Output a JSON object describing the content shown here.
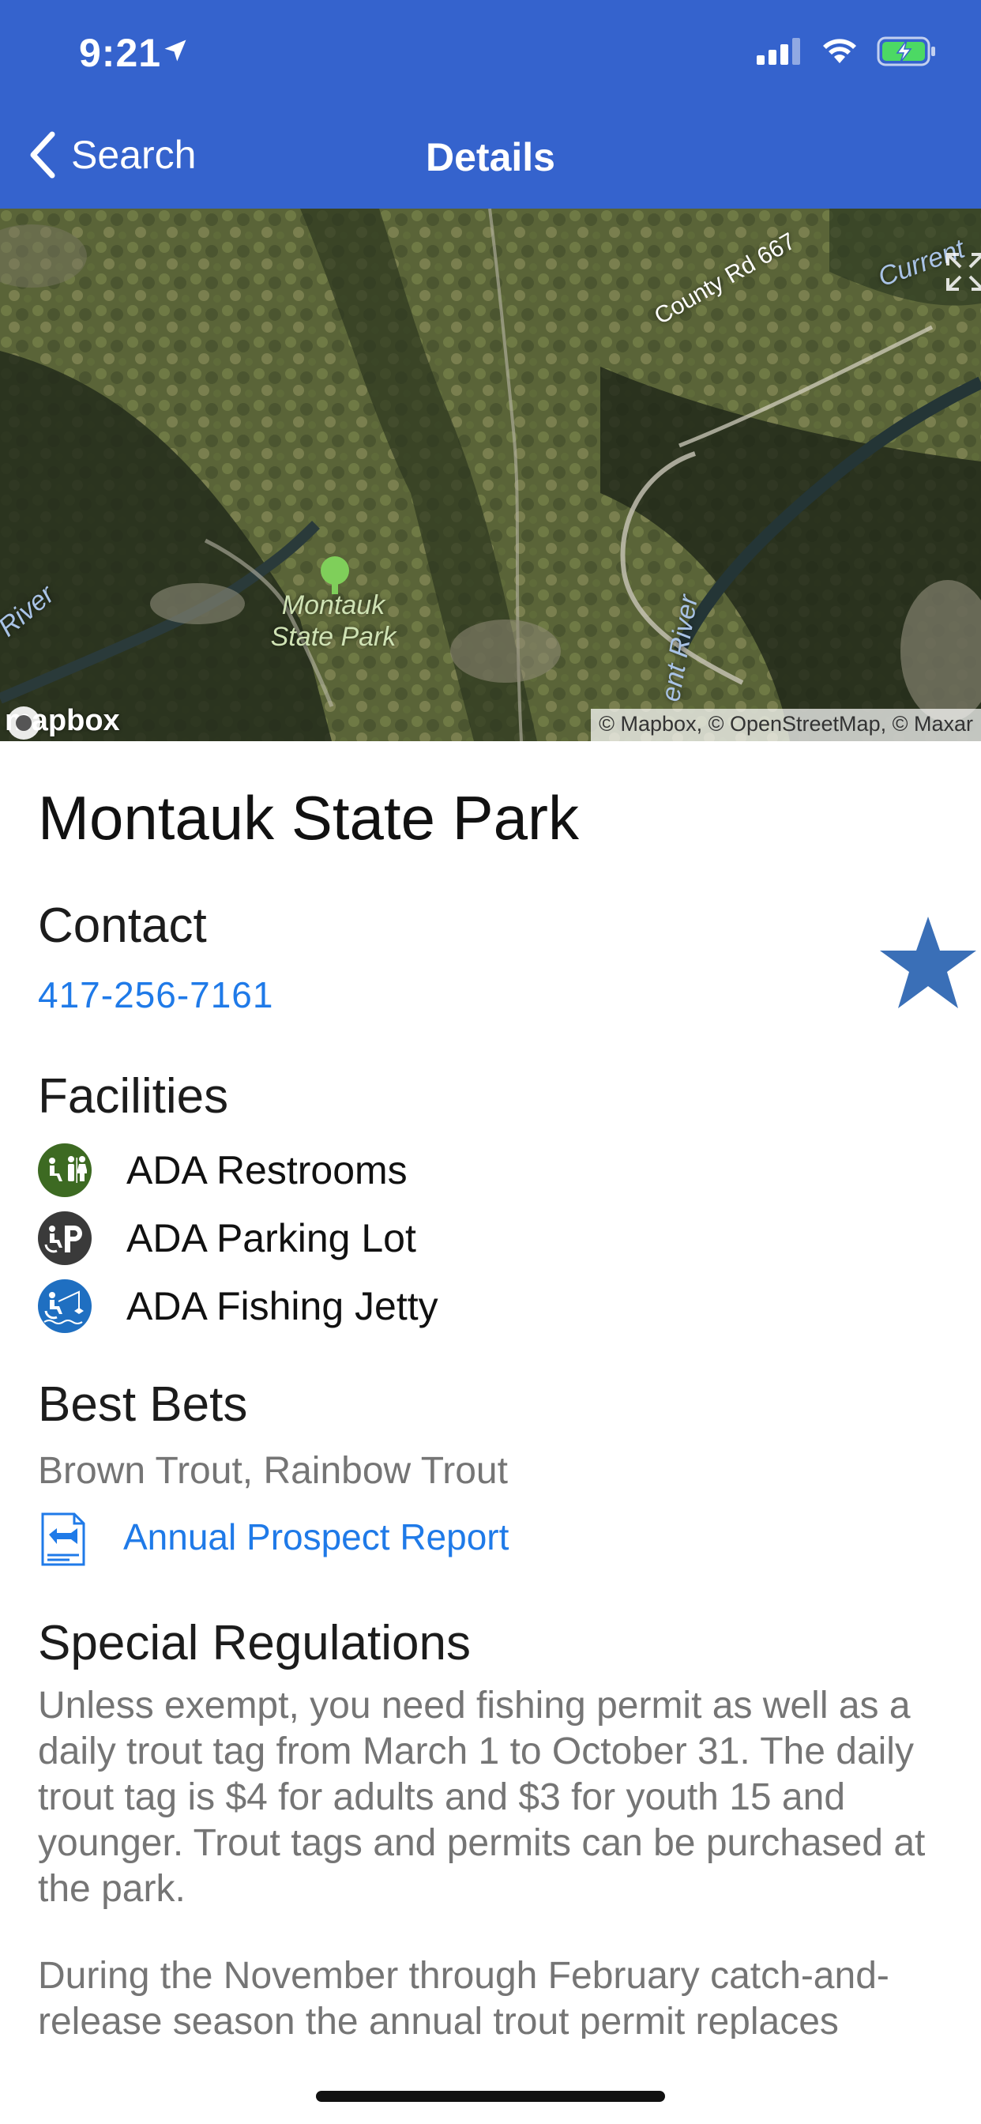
{
  "status_bar": {
    "time": "9:21",
    "icons": [
      "location-arrow-icon",
      "cellular-signal-icon",
      "wifi-icon",
      "battery-charging-icon"
    ]
  },
  "nav": {
    "back_label": "Search",
    "title": "Details"
  },
  "map": {
    "labels": {
      "road": "County Rd 667",
      "river_left": "River",
      "river_center": "ent River",
      "river_top_right": "Current",
      "park_line1": "Montauk",
      "park_line2": "State Park"
    },
    "logo": "mapbox",
    "attribution": "© Mapbox, © OpenStreetMap, © Maxar"
  },
  "park": {
    "name": "Montauk State Park"
  },
  "contact": {
    "heading": "Contact",
    "phone": "417-256-7161"
  },
  "favorite": {
    "icon": "star-icon",
    "color": "#3a6fb7"
  },
  "facilities": {
    "heading": "Facilities",
    "items": [
      {
        "label": "ADA Restrooms",
        "icon": "ada-restroom-icon",
        "color": "#3d6a22"
      },
      {
        "label": "ADA Parking Lot",
        "icon": "ada-parking-icon",
        "color": "#3a3a3a"
      },
      {
        "label": "ADA Fishing Jetty",
        "icon": "ada-fishing-jetty-icon",
        "color": "#1f6fc1"
      }
    ]
  },
  "best_bets": {
    "heading": "Best Bets",
    "species": "Brown Trout, Rainbow Trout",
    "report_link": "Annual Prospect Report"
  },
  "regulations": {
    "heading": "Special Regulations",
    "paragraphs": [
      "Unless exempt, you need fishing permit as well as a daily trout tag from March 1 to October 31. The daily trout tag is $4 for adults and $3 for youth 15 and younger. Trout tags and permits can be purchased at the park.",
      "During the November through February catch-and-release season the annual trout permit replaces"
    ]
  },
  "colors": {
    "header_bg": "#3563cd",
    "link": "#1f7ae8",
    "muted_text": "#757575"
  }
}
